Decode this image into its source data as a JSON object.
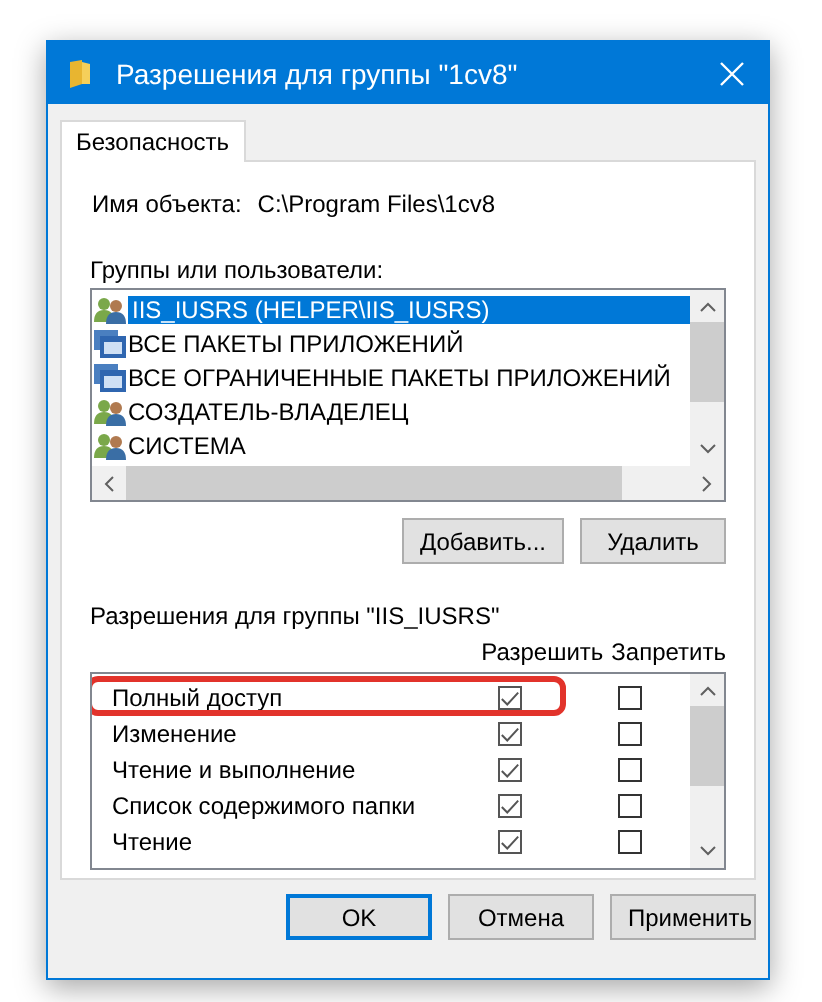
{
  "window": {
    "title": "Разрешения для группы \"1cv8\""
  },
  "tabs": [
    {
      "label": "Безопасность",
      "selected": true
    }
  ],
  "object_name": {
    "label": "Имя объекта:",
    "value": "C:\\Program Files\\1cv8"
  },
  "groups": {
    "label": "Группы или пользователи:",
    "items": [
      {
        "name": "IIS_IUSRS (HELPER\\IIS_IUSRS)",
        "kind": "users",
        "selected": true
      },
      {
        "name": "ВСЕ ПАКЕТЫ ПРИЛОЖЕНИЙ",
        "kind": "package",
        "selected": false
      },
      {
        "name": "ВСЕ ОГРАНИЧЕННЫЕ ПАКЕТЫ ПРИЛОЖЕНИЙ",
        "kind": "package",
        "selected": false
      },
      {
        "name": "СОЗДАТЕЛЬ-ВЛАДЕЛЕЦ",
        "kind": "users",
        "selected": false
      },
      {
        "name": "СИСТЕМА",
        "kind": "users",
        "selected": false
      }
    ]
  },
  "group_buttons": [
    "Добавить...",
    "Удалить"
  ],
  "permissions": {
    "label": "Разрешения для группы \"IIS_IUSRS\"",
    "columns": [
      "Разрешить",
      "Запретить"
    ],
    "rows": [
      {
        "name": "Полный доступ",
        "allow": true,
        "deny": false,
        "highlighted": true
      },
      {
        "name": "Изменение",
        "allow": true,
        "deny": false,
        "highlighted": false
      },
      {
        "name": "Чтение и выполнение",
        "allow": true,
        "deny": false,
        "highlighted": false
      },
      {
        "name": "Список содержимого папки",
        "allow": true,
        "deny": false,
        "highlighted": false
      },
      {
        "name": "Чтение",
        "allow": true,
        "deny": false,
        "highlighted": false
      }
    ]
  },
  "buttons": [
    {
      "label": "OK",
      "default": true
    },
    {
      "label": "Отмена",
      "default": false
    },
    {
      "label": "Применить",
      "default": false
    }
  ]
}
